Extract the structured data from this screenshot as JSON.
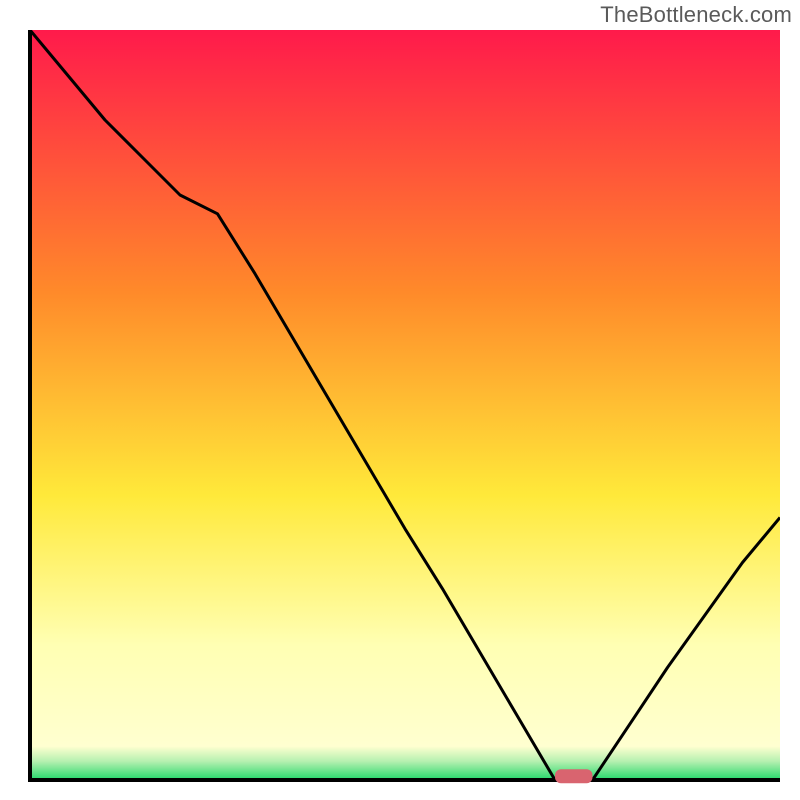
{
  "attribution": "TheBottleneck.com",
  "colors": {
    "gradient_top": "#ff1a4b",
    "gradient_mid_orange": "#ff8a2a",
    "gradient_mid_yellow": "#ffe93a",
    "gradient_pale_yellow": "#ffffb3",
    "gradient_green": "#22d76a",
    "axis": "#000000",
    "curve": "#000000",
    "marker": "#d9646f"
  },
  "chart_data": {
    "type": "line",
    "title": "",
    "xlabel": "",
    "ylabel": "",
    "x": [
      0,
      5,
      10,
      15,
      20,
      25,
      30,
      35,
      40,
      45,
      50,
      55,
      60,
      65,
      70,
      72,
      75,
      80,
      85,
      90,
      95,
      100
    ],
    "y": [
      100,
      94,
      88,
      83,
      78,
      75.5,
      67.5,
      59,
      50.5,
      42,
      33.5,
      25.5,
      17,
      8.5,
      0,
      0,
      0,
      7.5,
      15,
      22,
      29,
      35
    ],
    "xlim": [
      0,
      100
    ],
    "ylim": [
      0,
      100
    ],
    "grid": false,
    "legend": false,
    "marker": {
      "x_start": 70,
      "x_end": 75,
      "y": 0.5
    },
    "notes": "Linear gradient background from red at top through orange, yellow, pale yellow to green at bottom. Single V-shaped black curve with minimum near x≈70–75. Small rounded pink marker on x-axis at the minimum."
  }
}
